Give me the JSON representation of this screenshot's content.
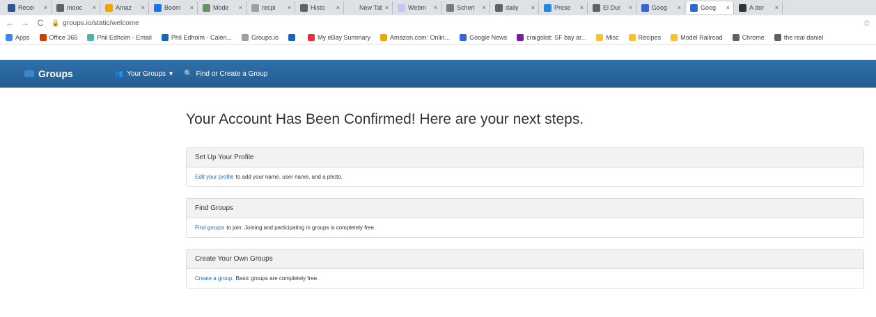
{
  "browser": {
    "tabs": [
      {
        "label": "Recei",
        "color": "#2b579a"
      },
      {
        "label": "mooc",
        "color": "#5f6368"
      },
      {
        "label": "Amaz",
        "color": "#f0a500"
      },
      {
        "label": "Boom",
        "color": "#1a73e8"
      },
      {
        "label": "Mode",
        "color": "#6b8e6b"
      },
      {
        "label": "recpi",
        "color": "#9aa0a6"
      },
      {
        "label": "Histo",
        "color": "#5f6368"
      },
      {
        "label": "New Tab",
        "color": "#dee1e6"
      },
      {
        "label": "Webm",
        "color": "#c5c5f0"
      },
      {
        "label": "Scheri",
        "color": "#7a7a7a"
      },
      {
        "label": "daily",
        "color": "#5f6368"
      },
      {
        "label": "Prese",
        "color": "#1e88e5"
      },
      {
        "label": "El Dur",
        "color": "#5f6368"
      },
      {
        "label": "Goog",
        "color": "#3367d6"
      },
      {
        "label": "Goog",
        "color": "#3367d6"
      },
      {
        "label": "A dor",
        "color": "#333333"
      }
    ],
    "active_tab_index": 14,
    "close_glyph": "×",
    "url": "groups.io/static/welcome",
    "back_glyph": "←",
    "forward_glyph": "→",
    "reload_glyph": "C",
    "lock_glyph": "🔒",
    "star_glyph": "☆",
    "bookmarks": [
      {
        "label": "Apps",
        "color": "#4285f4"
      },
      {
        "label": "Office 365",
        "color": "#d83b01"
      },
      {
        "label": "Phil Edholm - Email",
        "color": "#4db6ac"
      },
      {
        "label": "Phil Edholm - Calen...",
        "color": "#1565c0"
      },
      {
        "label": "Groups.io",
        "color": "#9aa0a6"
      },
      {
        "label": "",
        "color": "#1565c0"
      },
      {
        "label": "My eBay Summary",
        "color": "#e53238"
      },
      {
        "label": "Amazon.com: Onlin...",
        "color": "#f0a500"
      },
      {
        "label": "Google News",
        "color": "#3367d6"
      },
      {
        "label": "craigslist: SF bay ar...",
        "color": "#7b1fa2"
      },
      {
        "label": "Misc",
        "color": "#fbc02d"
      },
      {
        "label": "Recipes",
        "color": "#fbc02d"
      },
      {
        "label": "Model Railroad",
        "color": "#fbc02d"
      },
      {
        "label": "Chrome",
        "color": "#5f6368"
      },
      {
        "label": "the real daniel",
        "color": "#5f6368"
      }
    ]
  },
  "navbar": {
    "brand": "Groups",
    "your_groups": "Your Groups",
    "your_groups_caret": "▾",
    "find_create": "Find or Create a Group",
    "users_glyph": "👥",
    "search_glyph": "🔍"
  },
  "main": {
    "title": "Your Account Has Been Confirmed! Here are your next steps.",
    "panels": [
      {
        "heading": "Set Up Your Profile",
        "link": "Edit your profile",
        "text": "to add your name, user name, and a photo."
      },
      {
        "heading": "Find Groups",
        "link": "Find groups",
        "text": "to join. Joining and participating in groups is completely free."
      },
      {
        "heading": "Create Your Own Groups",
        "link": "Create a group.",
        "text": "Basic groups are completely free."
      }
    ]
  }
}
